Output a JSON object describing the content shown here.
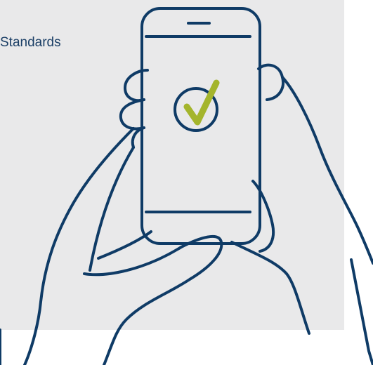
{
  "caption": {
    "text": "Standards"
  },
  "illustration": {
    "subject": "hands-holding-smartphone",
    "screen_icon": "check-circle-icon"
  },
  "colors": {
    "background": "#ffffff",
    "panel": "#e9e9ea",
    "line": "#0f3b66",
    "check": "#a4b52c",
    "caption_text": "#1b3f66"
  }
}
